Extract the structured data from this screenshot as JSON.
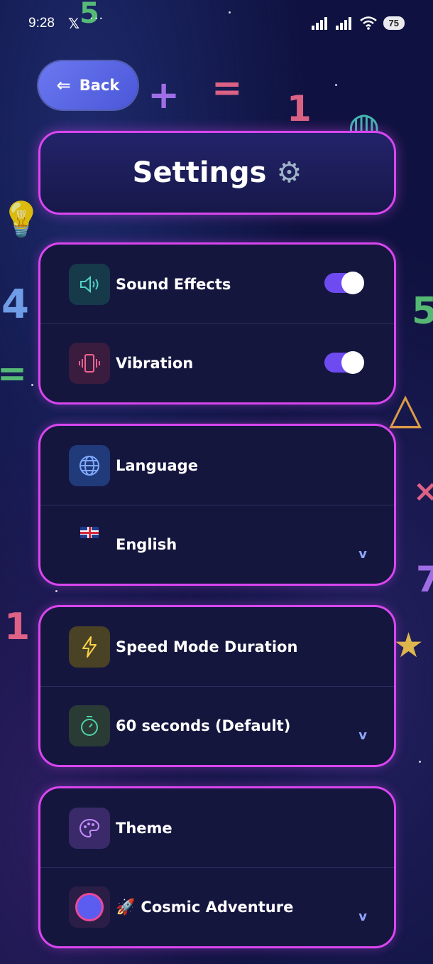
{
  "status_bar": {
    "time": "9:28",
    "x_icon": "x-logo-icon",
    "dots": "···",
    "battery": "75"
  },
  "header": {
    "back_label": "Back",
    "title": "Settings"
  },
  "sections": {
    "audio": {
      "sound_effects_label": "Sound Effects",
      "sound_effects_on": true,
      "vibration_label": "Vibration",
      "vibration_on": true
    },
    "language": {
      "label": "Language",
      "selected": "English"
    },
    "speed_mode": {
      "label": "Speed Mode Duration",
      "selected": "60 seconds (Default)"
    },
    "theme": {
      "label": "Theme",
      "selected": "Cosmic Adventure"
    }
  },
  "colors": {
    "accent_border": "#d946ef",
    "toggle_on": "#6d4bf0",
    "back_button": "#5a66e6",
    "chevron": "#8fa6ff",
    "background": "#0f1240"
  },
  "icons": {
    "sound": "speaker-icon",
    "vibration": "vibration-icon",
    "language": "globe-icon",
    "speed": "lightning-icon",
    "timer": "stopwatch-icon",
    "theme": "palette-icon",
    "flag": "uk-flag-icon",
    "rocket": "rocket-icon"
  }
}
